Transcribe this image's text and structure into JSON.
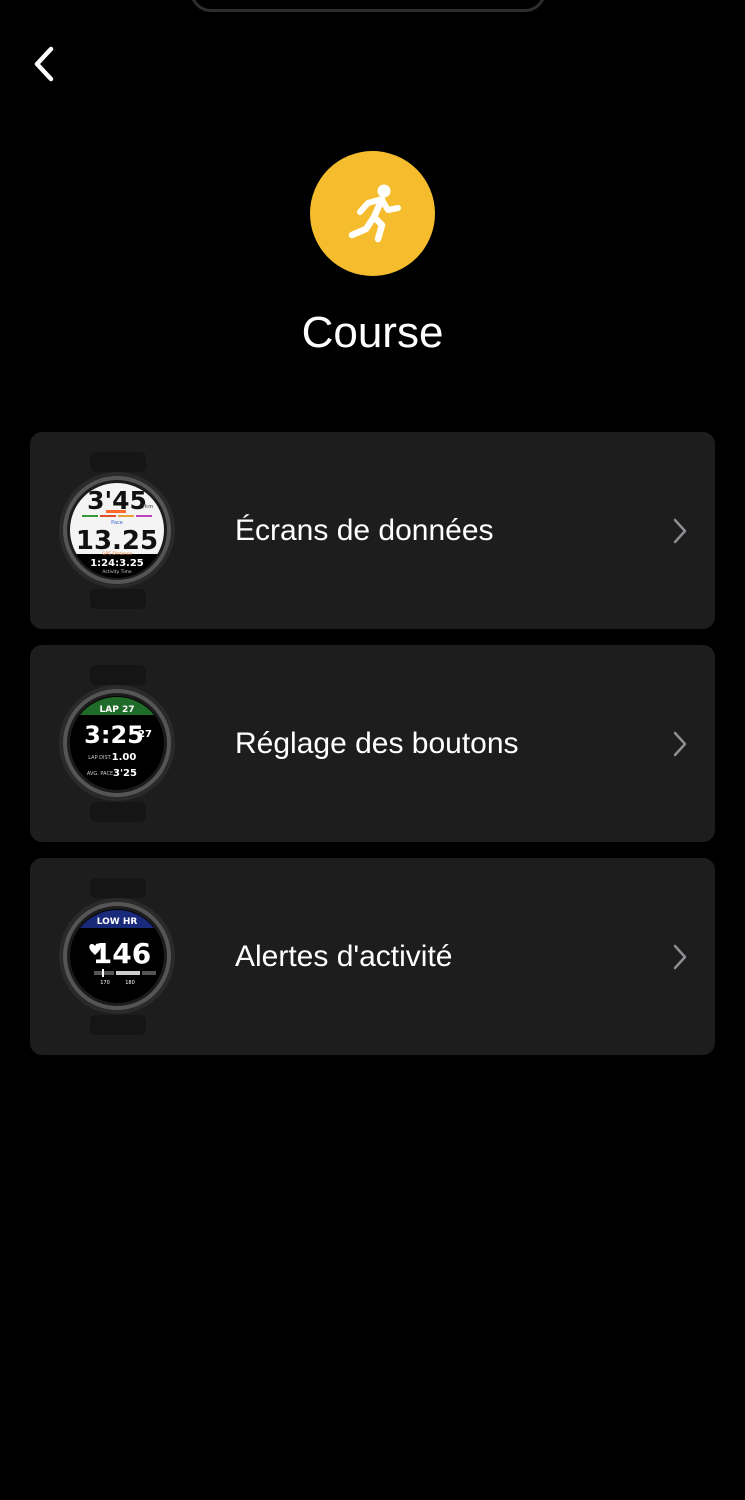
{
  "header": {
    "back_icon": "chevron-left-icon"
  },
  "activity": {
    "icon": "running-person-icon",
    "badge_color": "#f5bd2d",
    "title": "Course"
  },
  "menu": {
    "items": [
      {
        "label": "Écrans de données",
        "watch": {
          "line1": "3'45",
          "line1_unit": "/km",
          "line1_label": "Pace",
          "line2": "13.25",
          "line2_label": "GPS Distance",
          "line3": "1:24:3.25",
          "line3_label": "Activity Time"
        }
      },
      {
        "label": "Réglage des boutons",
        "watch": {
          "header": "LAP 27",
          "main": "3:25",
          "main_sub": "27",
          "row1_label": "LAP DIST.",
          "row1_value": "1.00",
          "row2_label": "AVG. PACE",
          "row2_value": "3'25"
        }
      },
      {
        "label": "Alertes d'activité",
        "watch": {
          "header": "LOW HR",
          "value": "146",
          "scale_low": "170",
          "scale_high": "180"
        }
      }
    ],
    "chevron_icon": "chevron-right-icon"
  },
  "colors": {
    "background": "#000000",
    "card": "#1d1d1d",
    "accent": "#f5bd2d",
    "chevron": "#8e8e93"
  }
}
